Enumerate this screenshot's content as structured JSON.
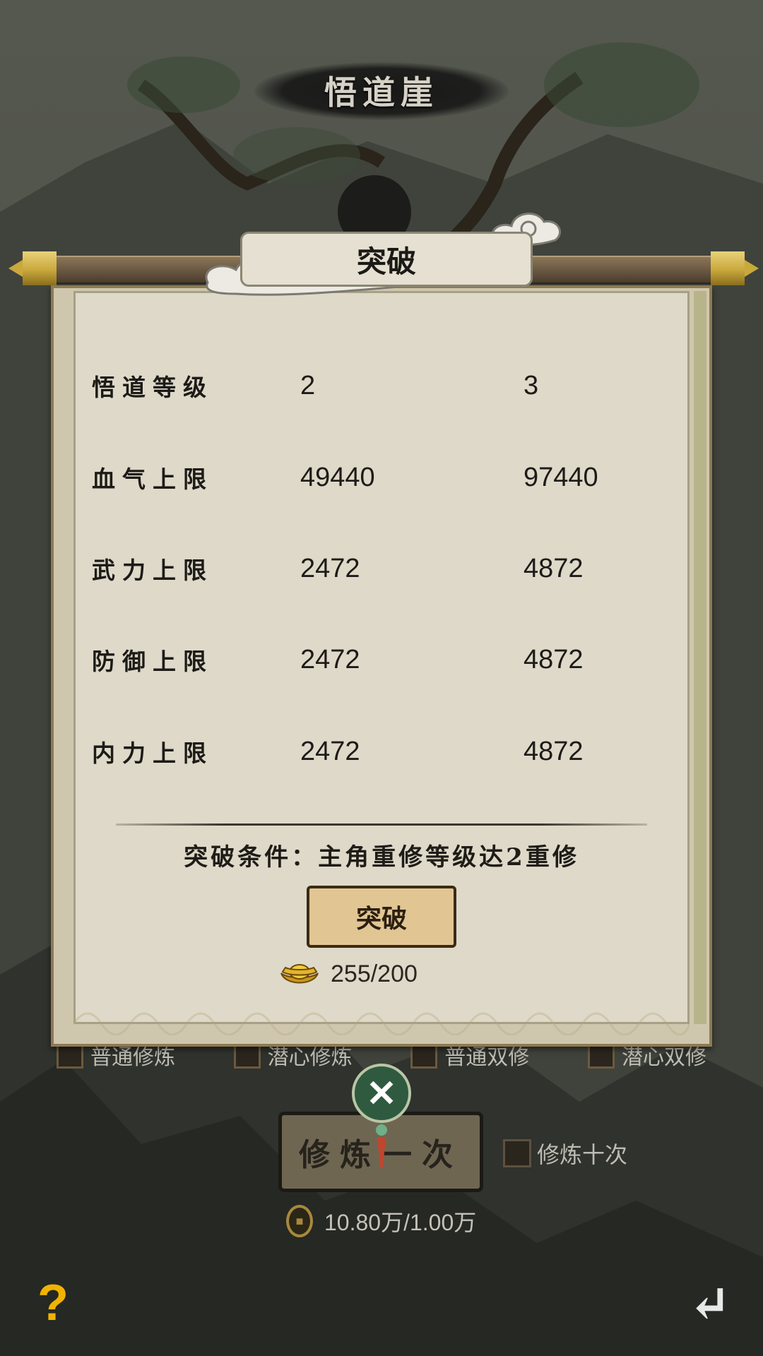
{
  "location": {
    "title": "悟道崖"
  },
  "dialog": {
    "tab_title": "突破",
    "stats": [
      {
        "name": "悟道等级",
        "current": "2",
        "next": "3"
      },
      {
        "name": "血气上限",
        "current": "49440",
        "next": "97440"
      },
      {
        "name": "武力上限",
        "current": "2472",
        "next": "4872"
      },
      {
        "name": "防御上限",
        "current": "2472",
        "next": "4872"
      },
      {
        "name": "内力上限",
        "current": "2472",
        "next": "4872"
      }
    ],
    "condition": "突破条件：主角重修等级达2重修",
    "button_label": "突破",
    "cost": {
      "icon": "gold-ingot-icon",
      "value": "255/200"
    }
  },
  "training": {
    "modes": [
      "普通修炼",
      "潜心修炼",
      "普通双修",
      "潜心双修"
    ],
    "train_button": "修炼一次",
    "ten_times": "修炼十次",
    "cost": {
      "icon": "copper-coin-icon",
      "value": "10.80万/1.00万"
    }
  },
  "corner": {
    "help": "?",
    "back": "↵"
  },
  "colors": {
    "paper": "#ded9c8",
    "button": "#e1c593",
    "gold": "#c9a83c",
    "help": "#f0b400"
  }
}
